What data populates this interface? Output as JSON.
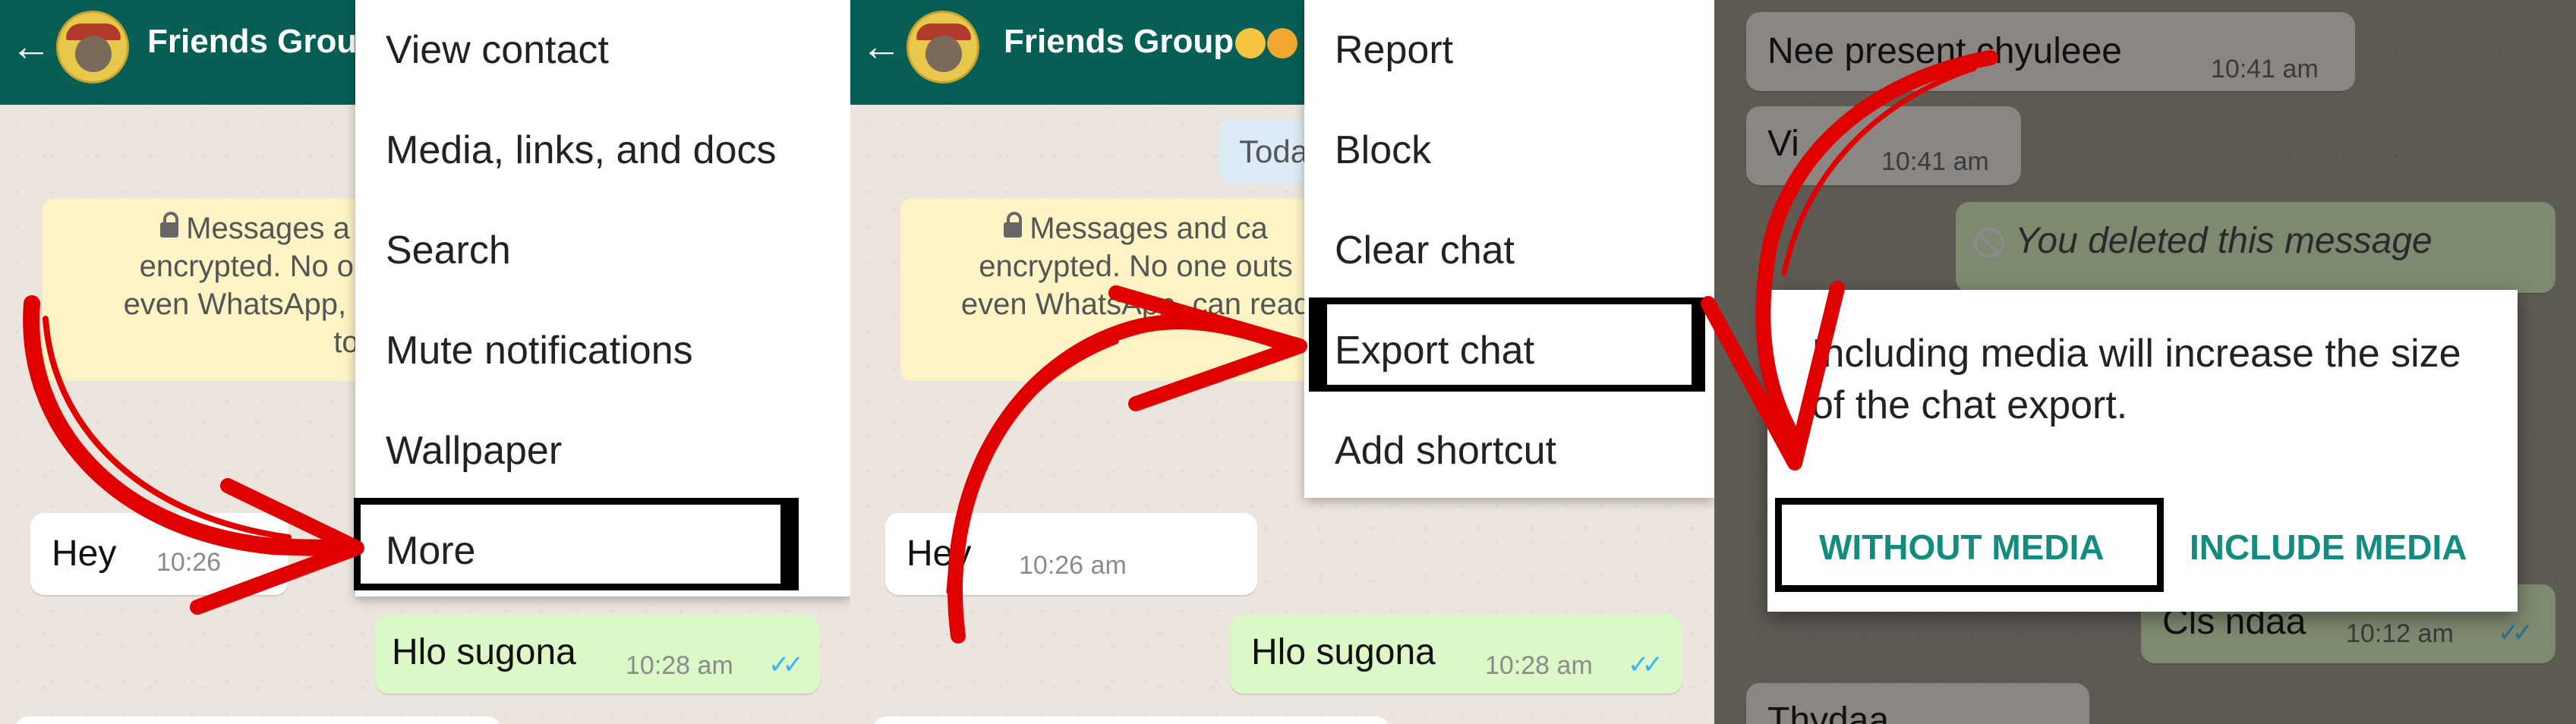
{
  "panel1": {
    "chat_title": "Friends Grou",
    "banner_lines": [
      "Messages a",
      "encrypted. No on",
      "even WhatsApp, ca",
      "to"
    ],
    "incoming": {
      "text": "Hey",
      "time": "10:26"
    },
    "outgoing": {
      "text": "Hlo sugona",
      "time": "10:28 am"
    },
    "menu_items": [
      "View contact",
      "Media, links, and docs",
      "Search",
      "Mute notifications",
      "Wallpaper",
      "More"
    ],
    "highlighted_item": "More"
  },
  "panel2": {
    "chat_title": "Friends Group",
    "date_chip": "Toda",
    "banner_lines": [
      "Messages and ca",
      "encrypted. No one outs",
      "even WhatsApp, can read",
      ""
    ],
    "incoming": {
      "text": "Hey",
      "time": "10:26 am"
    },
    "outgoing": {
      "text": "Hlo sugona",
      "time": "10:28 am"
    },
    "menu_items": [
      "Report",
      "Block",
      "Clear chat",
      "Export chat",
      "Add shortcut"
    ],
    "highlighted_item": "Export chat"
  },
  "panel3": {
    "messages": [
      {
        "text": "Nee present chyuleee",
        "time": "10:41 am"
      },
      {
        "text": "Vi",
        "time": "10:41 am"
      },
      {
        "text": "You deleted this message",
        "time": ""
      },
      {
        "text": "Cls ndaa",
        "time": "10:12 am"
      },
      {
        "text": "Thydaa",
        "time": ""
      }
    ],
    "dialog": {
      "text": "Including media will increase the size of the chat export.",
      "without_media": "WITHOUT MEDIA",
      "include_media": "INCLUDE MEDIA"
    }
  },
  "colors": {
    "header": "#075e54",
    "accent": "#128c7e",
    "outgoing_bubble": "#dcf8c6",
    "incoming_bubble": "#ffffff",
    "annotation_arrow": "#e00000",
    "highlight_box": "#000000"
  },
  "icons": [
    "back-arrow-icon",
    "lock-icon",
    "double-check-icon",
    "ban-icon"
  ]
}
